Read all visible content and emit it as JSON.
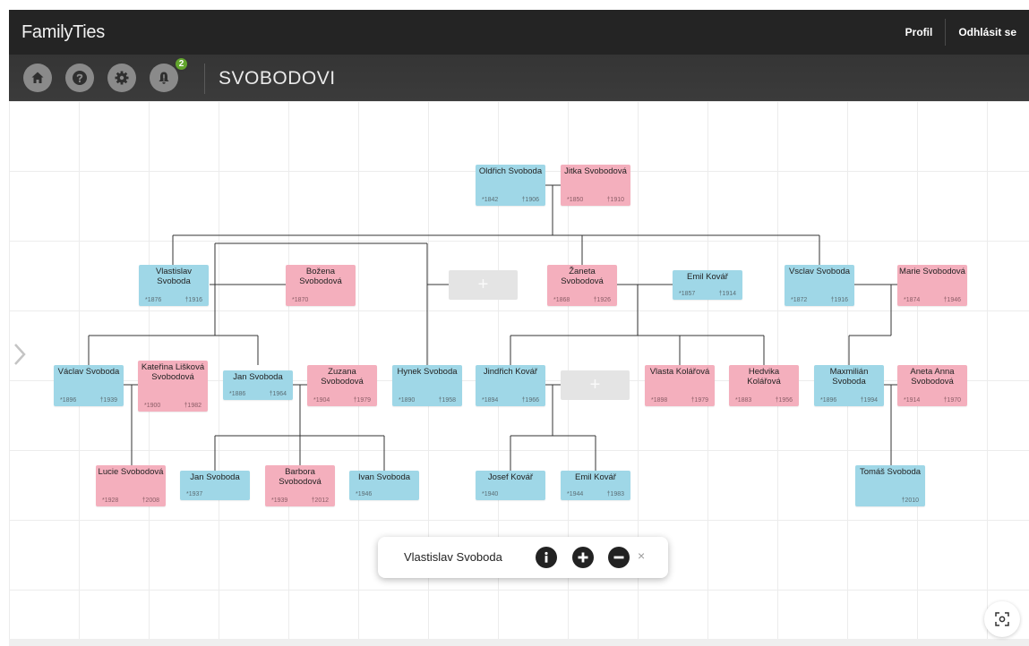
{
  "app": {
    "brand": "FamilyTies"
  },
  "nav": {
    "profile": "Profil",
    "logout": "Odhlásit se"
  },
  "toolbar": {
    "notifications_count": "2",
    "tree_title": "SVOBODOVI"
  },
  "tree": {
    "people": [
      {
        "id": "oldrich",
        "name": "Oldřich Svoboda",
        "born": "*1842",
        "died": "†1906",
        "gender": "m"
      },
      {
        "id": "jitka",
        "name": "Jitka Svobodová",
        "born": "*1850",
        "died": "†1910",
        "gender": "f"
      },
      {
        "id": "vlastislav",
        "name": "Vlastislav Svoboda",
        "born": "*1876",
        "died": "†1916",
        "gender": "m"
      },
      {
        "id": "bozena",
        "name": "Božena Svobodová",
        "born": "*1870",
        "died": "",
        "gender": "f"
      },
      {
        "id": "zaneta",
        "name": "Žaneta Svobodová",
        "born": "*1868",
        "died": "†1926",
        "gender": "f"
      },
      {
        "id": "emil1",
        "name": "Emil Kovář",
        "born": "*1857",
        "died": "†1914",
        "gender": "m"
      },
      {
        "id": "vsclav",
        "name": "Vsclav Svoboda",
        "born": "*1872",
        "died": "†1916",
        "gender": "m"
      },
      {
        "id": "marie",
        "name": "Marie Svobodová",
        "born": "*1874",
        "died": "†1946",
        "gender": "f"
      },
      {
        "id": "vaclav",
        "name": "Václav Svoboda",
        "born": "*1896",
        "died": "†1939",
        "gender": "m"
      },
      {
        "id": "katerina",
        "name": "Kateřina Lišková Svobodová",
        "born": "*1900",
        "died": "†1982",
        "gender": "f"
      },
      {
        "id": "jan1",
        "name": "Jan Svoboda",
        "born": "*1886",
        "died": "†1964",
        "gender": "m"
      },
      {
        "id": "zuzana",
        "name": "Zuzana Svobodová",
        "born": "*1904",
        "died": "†1979",
        "gender": "f"
      },
      {
        "id": "hynek",
        "name": "Hynek Svoboda",
        "born": "*1890",
        "died": "†1958",
        "gender": "m"
      },
      {
        "id": "jindrich",
        "name": "Jindřich Kovář",
        "born": "*1894",
        "died": "†1966",
        "gender": "m"
      },
      {
        "id": "vlasta",
        "name": "Vlasta Kolářová",
        "born": "*1898",
        "died": "†1979",
        "gender": "f"
      },
      {
        "id": "hedvika",
        "name": "Hedvika Kolářová",
        "born": "*1883",
        "died": "†1956",
        "gender": "f"
      },
      {
        "id": "maxmilian",
        "name": "Maxmilián Svoboda",
        "born": "*1896",
        "died": "†1994",
        "gender": "m"
      },
      {
        "id": "aneta",
        "name": "Aneta Anna Svobodová",
        "born": "*1914",
        "died": "†1970",
        "gender": "f"
      },
      {
        "id": "lucie",
        "name": "Lucie Svobodová",
        "born": "*1928",
        "died": "†2008",
        "gender": "f"
      },
      {
        "id": "jan2",
        "name": "Jan Svoboda",
        "born": "*1937",
        "died": "",
        "gender": "m"
      },
      {
        "id": "barbora",
        "name": "Barbora Svobodová",
        "born": "*1939",
        "died": "†2012",
        "gender": "f"
      },
      {
        "id": "ivan",
        "name": "Ivan Svoboda",
        "born": "*1946",
        "died": "",
        "gender": "m"
      },
      {
        "id": "josef",
        "name": "Josef Kovář",
        "born": "*1940",
        "died": "",
        "gender": "m"
      },
      {
        "id": "emil2",
        "name": "Emil Kovář",
        "born": "*1944",
        "died": "†1983",
        "gender": "m"
      },
      {
        "id": "tomas",
        "name": "Tomáš Svoboda",
        "born": "",
        "died": "†2010",
        "gender": "m"
      }
    ],
    "add_slot_label": "+"
  },
  "popup": {
    "selected_name": "Vlastislav Svoboda",
    "close_label": "×"
  },
  "colors": {
    "male": "#9fd7e7",
    "female": "#f4afbd",
    "header": "#242424",
    "toolbar": "#353535"
  }
}
